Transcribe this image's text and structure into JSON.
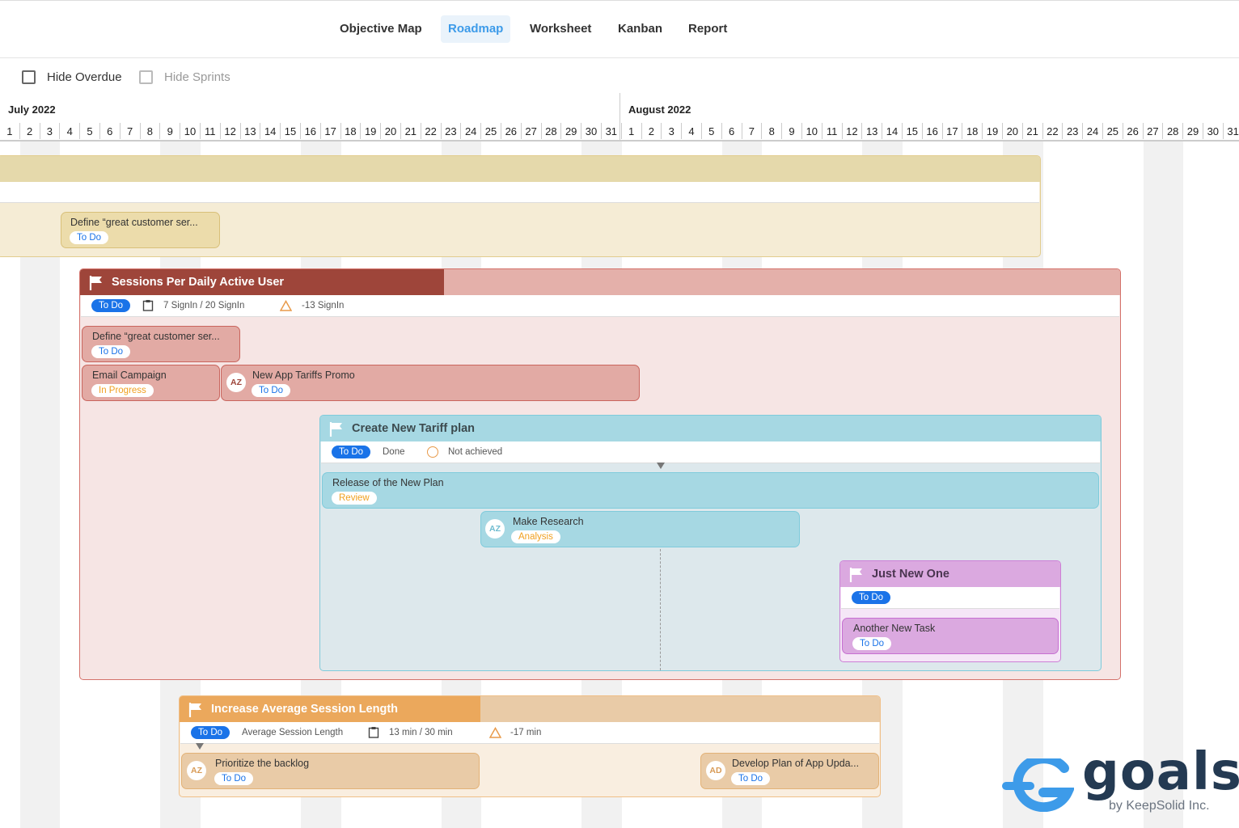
{
  "nav": {
    "tabs": [
      {
        "label": "Objective Map"
      },
      {
        "label": "Roadmap"
      },
      {
        "label": "Worksheet"
      },
      {
        "label": "Kanban"
      },
      {
        "label": "Report"
      }
    ]
  },
  "filters": {
    "hide_overdue": "Hide Overdue",
    "hide_sprints": "Hide Sprints"
  },
  "timeline": {
    "months": [
      "July 2022",
      "August 2022"
    ],
    "july_days": [
      "1",
      "2",
      "3",
      "4",
      "5",
      "6",
      "7",
      "8",
      "9",
      "10",
      "11",
      "12",
      "13",
      "14",
      "15",
      "16",
      "17",
      "18",
      "19",
      "20",
      "21",
      "22",
      "23",
      "24",
      "25",
      "26",
      "27",
      "28",
      "29",
      "30",
      "31"
    ],
    "august_days": [
      "1",
      "2",
      "3",
      "4",
      "5",
      "6",
      "7",
      "8",
      "9",
      "10",
      "11",
      "12",
      "13",
      "14",
      "15",
      "16",
      "17",
      "18",
      "19",
      "20",
      "21",
      "22",
      "23",
      "24",
      "25",
      "26",
      "27",
      "28",
      "29",
      "30",
      "31"
    ]
  },
  "objectives": {
    "top": {
      "task": {
        "title": "Define “great customer ser...",
        "status": "To Do"
      }
    },
    "sessions": {
      "title": "Sessions Per Daily Active User",
      "status": "To Do",
      "progress_text": "7 SignIn / 20 SignIn",
      "delta": "-13 SignIn",
      "progress_fraction": 0.35,
      "tasks": [
        {
          "title": "Define “great customer ser...",
          "status": "To Do"
        },
        {
          "title": "Email Campaign",
          "status": "In Progress"
        },
        {
          "title": "New App Tariffs Promo",
          "status": "To Do",
          "avatar": "AZ"
        }
      ]
    },
    "tariff": {
      "title": "Create New Tariff plan",
      "status": "To Do",
      "done_label": "Done",
      "not_achieved_label": "Not achieved",
      "tasks": [
        {
          "title": "Release of the New Plan",
          "status": "Review"
        },
        {
          "title": "Make Research",
          "status": "Analysis",
          "avatar": "AZ"
        }
      ]
    },
    "justnew": {
      "title": "Just New One",
      "status": "To Do",
      "tasks": [
        {
          "title": "Another New Task",
          "status": "To Do"
        }
      ]
    },
    "session_length": {
      "title": "Increase Average Session Length",
      "status": "To Do",
      "metric": "Average Session Length",
      "progress_text": "13 min / 30 min",
      "delta": "-17 min",
      "progress_fraction": 0.43,
      "tasks": [
        {
          "title": "Prioritize the backlog",
          "status": "To Do",
          "avatar": "AZ"
        },
        {
          "title": "Develop Plan of App Upda...",
          "status": "To Do",
          "avatar": "AD"
        }
      ]
    }
  },
  "logo": {
    "name": "goals",
    "by": "by KeepSolid Inc."
  },
  "colors": {
    "accent_blue": "#1a73e8",
    "sessions_header": "#9e453a",
    "tariff_header": "#a6d8e3",
    "justnew_header": "#dba9e0",
    "length_header": "#eba85c"
  }
}
